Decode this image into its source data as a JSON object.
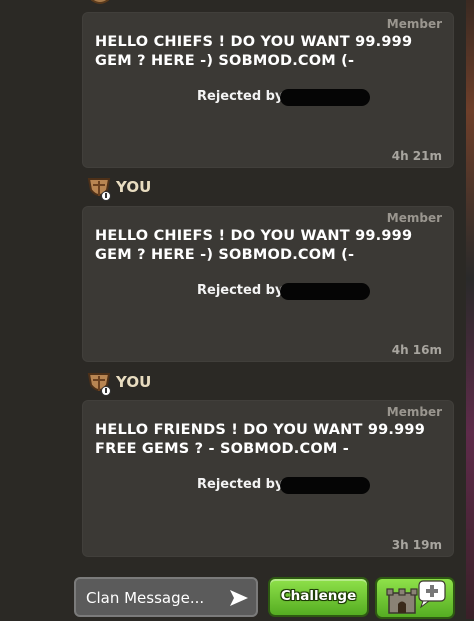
{
  "messages": [
    {
      "sender": "",
      "role": "Member",
      "text": "HELLO CHIEFS ! DO YOU WANT 99.999 GEM ? HERE -) SOBMOD.COM (-",
      "status": "Rejected by",
      "time": "4h 21m"
    },
    {
      "sender": "YOU",
      "role": "Member",
      "text": "HELLO CHIEFS ! DO YOU WANT 99.999 GEM ? HERE -) SOBMOD.COM (-",
      "status": "Rejected by",
      "time": "4h 16m"
    },
    {
      "sender": "YOU",
      "role": "Member",
      "text": "HELLO FRIENDS ! DO YOU WANT 99.999 FREE GEMS ? - SOBMOD.COM -",
      "status": "Rejected by",
      "time": "3h 19m"
    }
  ],
  "composer": {
    "placeholder": "Clan Message...",
    "send_icon": "send-arrow-icon"
  },
  "actions": {
    "challenge_label": "Challenge",
    "castle_icon": "castle-add-icon"
  },
  "colors": {
    "background": "#2b2925",
    "bubble": "#3b3935",
    "accent_green": "#6cc72f",
    "you_label": "#e8dcc0"
  }
}
